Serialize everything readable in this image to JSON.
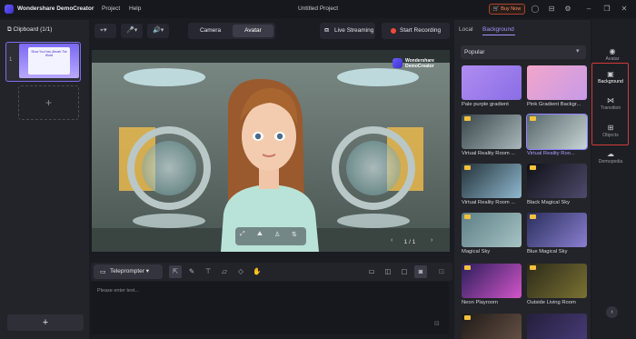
{
  "titlebar": {
    "app_name": "Wondershare DemoCreator",
    "menu": [
      "Project",
      "Help"
    ],
    "document_title": "Untitled Project",
    "buy_label": "Buy Now",
    "icons": [
      "account-icon",
      "gift-icon",
      "settings-icon",
      "minimize-icon",
      "maximize-icon",
      "close-icon"
    ]
  },
  "clipboard": {
    "title": "Clipboard (1/1)",
    "thumb_text": "Show You How, Absorb The World",
    "add_symbol": "+",
    "bottom_add_symbol": "+"
  },
  "toolbar": {
    "mode_tabs": [
      "Camera",
      "Avatar"
    ],
    "active_mode": "Avatar",
    "live_label": "Live Streaming",
    "record_label": "Start Recording"
  },
  "preview": {
    "watermark_line1": "Wondershare",
    "watermark_line2": "DemoCreator",
    "page_indicator": "1 / 1"
  },
  "teleprompter": {
    "button_label": "Teleprompter",
    "placeholder": "Please enter text..."
  },
  "right_panel": {
    "tabs": [
      "Local",
      "Background"
    ],
    "active_tab": "Background",
    "filter_value": "Popular",
    "backgrounds": [
      {
        "label": "Pale purple gradient",
        "premium": false,
        "selected": false,
        "color_a": "#b08cf0",
        "color_b": "#8a6ee6"
      },
      {
        "label": "Pink Gradient Backgr...",
        "premium": false,
        "selected": false,
        "color_a": "#f2a6c9",
        "color_b": "#c79ae8"
      },
      {
        "label": "Virtual Reality Room ...",
        "premium": true,
        "selected": false,
        "color_a": "#39474c",
        "color_b": "#a9b7ba"
      },
      {
        "label": "Virtual Reality Roo...",
        "premium": true,
        "selected": true,
        "color_a": "#56666a",
        "color_b": "#c8d4d5"
      },
      {
        "label": "Virtual Reality Room ...",
        "premium": true,
        "selected": false,
        "color_a": "#243238",
        "color_b": "#8fb8d0"
      },
      {
        "label": "Black Magical Sky",
        "premium": true,
        "selected": false,
        "color_a": "#101118",
        "color_b": "#4f4a6b"
      },
      {
        "label": "Magical Sky",
        "premium": true,
        "selected": false,
        "color_a": "#5d7f86",
        "color_b": "#a7c3c4"
      },
      {
        "label": "Blue Magical Sky",
        "premium": true,
        "selected": false,
        "color_a": "#2a2f5c",
        "color_b": "#8a7fd0"
      },
      {
        "label": "Neon Playroom",
        "premium": true,
        "selected": false,
        "color_a": "#2a1e5a",
        "color_b": "#d355c9"
      },
      {
        "label": "Outside Living Room",
        "premium": true,
        "selected": false,
        "color_a": "#2c2a1a",
        "color_b": "#7a7232"
      },
      {
        "label": "",
        "premium": true,
        "selected": false,
        "color_a": "#1f1a18",
        "color_b": "#6b5548"
      },
      {
        "label": "",
        "premium": false,
        "selected": false,
        "color_a": "#241f3c",
        "color_b": "#4a3d7a"
      }
    ]
  },
  "side_nav": {
    "items": [
      {
        "label": "Avatar",
        "icon": "avatar-icon",
        "glyph": "◉"
      },
      {
        "label": "Background",
        "icon": "background-icon",
        "glyph": "▣"
      },
      {
        "label": "Transition",
        "icon": "transition-icon",
        "glyph": "⋈"
      },
      {
        "label": "Objects",
        "icon": "objects-icon",
        "glyph": "⊞"
      },
      {
        "label": "Demopedia",
        "icon": "demopedia-icon",
        "glyph": "☁"
      }
    ],
    "active": "Background",
    "collapse_glyph": "›"
  },
  "colors": {
    "accent": "#8f83ff",
    "highlight_box": "#d33a3a",
    "record_red": "#f04a3a",
    "buy_orange": "#f08a5d"
  }
}
